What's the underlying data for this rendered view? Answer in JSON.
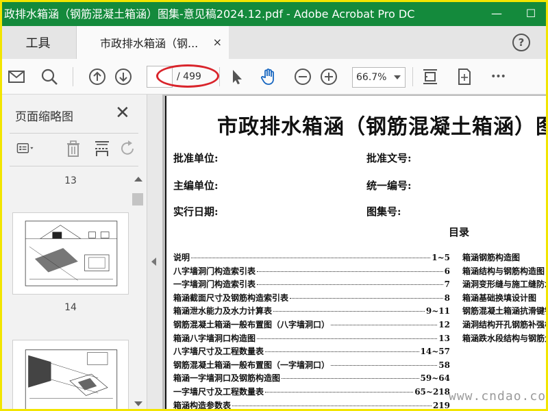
{
  "window": {
    "title": "政排水箱涵（钢筋混凝土箱涵）图集-意见稿2024.12.pdf - Adobe Acrobat Pro DC",
    "minimize": "—",
    "maximize": "☐"
  },
  "tabs": {
    "tools_label": "工具",
    "doc_label": "市政排水箱涵（钢...",
    "close": "×",
    "help": "?"
  },
  "toolbar": {
    "page_current": "",
    "page_total": "/ 499",
    "zoom": "66.7%",
    "more": "•••"
  },
  "left_panel": {
    "title": "页面缩略图",
    "close": "✕",
    "thumbnails": [
      {
        "page_label": "13"
      },
      {
        "page_label": "14"
      }
    ]
  },
  "document": {
    "title": "市政排水箱涵（钢筋混凝土箱涵）图集",
    "fields": {
      "approval_unit": "批准单位:",
      "approval_number": "批准文号:",
      "editor_unit": "主编单位:",
      "unified_number": "统一编号:",
      "effective_date": "实行日期:",
      "atlas_number": "图集号:"
    },
    "toc_heading": "目录",
    "toc_left": [
      {
        "title": "说明",
        "page": "1~5"
      },
      {
        "title": "八字墙洞门构造索引表",
        "page": "6"
      },
      {
        "title": "一字墙洞门构造索引表",
        "page": "7"
      },
      {
        "title": "箱涵截面尺寸及钢筋构造索引表",
        "page": "8"
      },
      {
        "title": "箱涵泄水能力及水力计算表",
        "page": "9~11"
      },
      {
        "title": "钢筋混凝土箱涵一般布置图（八字墙洞口）",
        "page": "12"
      },
      {
        "title": "箱涵八字墙洞口构造图",
        "page": "13"
      },
      {
        "title": "八字墙尺寸及工程数量表",
        "page": "14~57"
      },
      {
        "title": "钢筋混凝土箱涵一般布置图（一字墙洞口）",
        "page": "58"
      },
      {
        "title": "箱涵一字墙洞口及钢筋构造图",
        "page": "59~64"
      },
      {
        "title": "一字墙尺寸及工程数量表",
        "page": "65~218"
      },
      {
        "title": "箱涵构造参数表",
        "page": "219"
      }
    ],
    "toc_right": [
      {
        "title": "箱涵钢筋构造图"
      },
      {
        "title": "箱涵结构与钢筋构造图"
      },
      {
        "title": "涵洞变形缝与施工缝防水"
      },
      {
        "title": "箱涵基础换填设计图"
      },
      {
        "title": "钢筋混凝土箱涵抗滑键钢"
      },
      {
        "title": "涵洞结构开孔钢筋补强构"
      },
      {
        "title": "箱涵跌水段结构与钢筋大"
      }
    ]
  },
  "watermark": "www.cndao.com"
}
